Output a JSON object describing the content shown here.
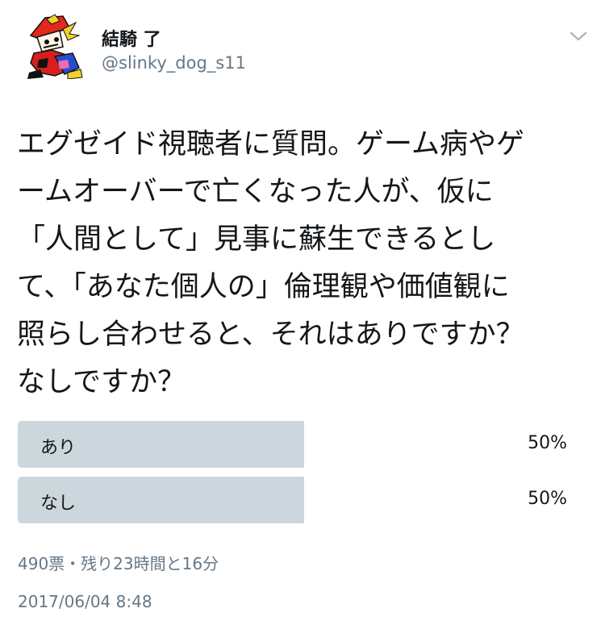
{
  "author": {
    "display_name": "結騎 了",
    "handle": "@slinky_dog_s11",
    "avatar_icon": "avatar-illustration-icon"
  },
  "header": {
    "menu_icon": "chevron-down-icon"
  },
  "tweet": {
    "text": "エグゼイド視聴者に質問。ゲーム病やゲ\nームオーバーで亡くなった人が、仮に\n「人間として」見事に蘇生できるとし\nて、「あなた個人の」倫理観や価値観に\n照らし合わせると、それはありですか？\nなしですか？"
  },
  "poll": {
    "options": [
      {
        "label": "あり",
        "percent": "50%",
        "share": 0.5
      },
      {
        "label": "なし",
        "percent": "50%",
        "share": 0.5
      }
    ],
    "meta": "490票・残り23時間と16分"
  },
  "timestamp": "2017/06/04 8:48",
  "colors": {
    "poll_fill": "#ccd6dd",
    "secondary_text": "#657786",
    "primary_text": "#14171a"
  }
}
